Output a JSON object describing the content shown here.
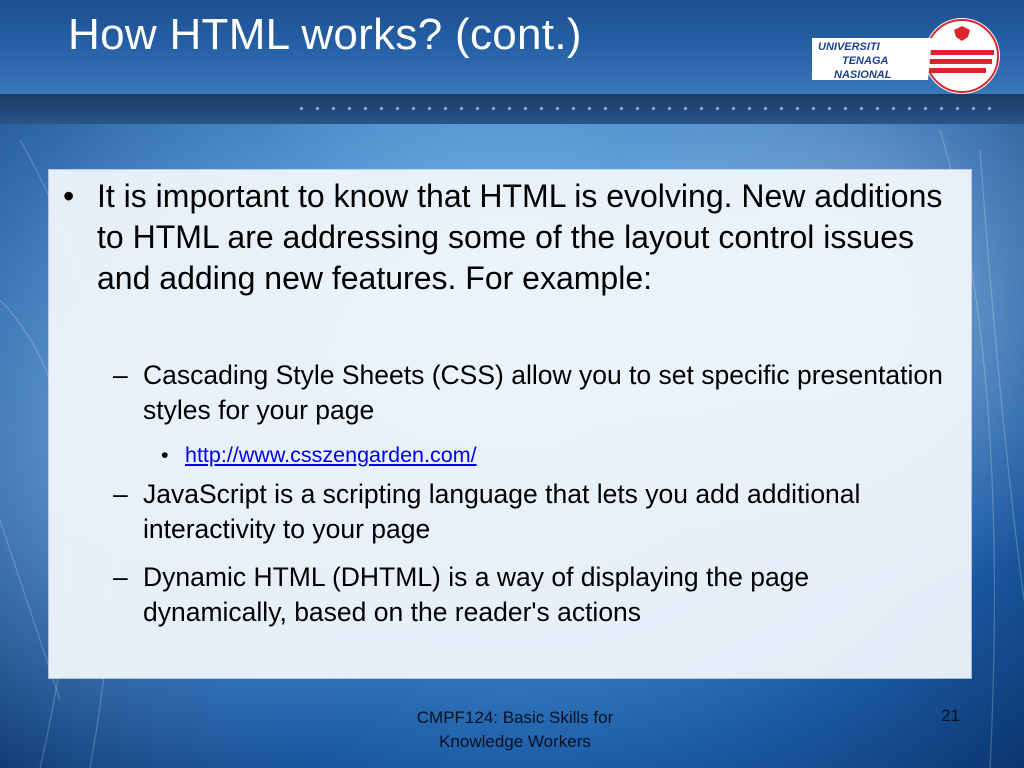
{
  "slide": {
    "title": "How HTML works? (cont.)",
    "logo": {
      "text_line1": "UNIVERSITI",
      "text_line2": "TENAGA",
      "text_line3": "NASIONAL",
      "primary_color": "#d9262c",
      "text_color": "#1f3f8f"
    },
    "bullets": {
      "main": {
        "marker": "•",
        "text": "It is important to know that HTML is evolving. New additions to HTML are addressing some of the layout control issues and adding new features. For example:"
      },
      "sub1": {
        "marker": "–",
        "text": "Cascading Style Sheets (CSS) allow you to set specific presentation styles for your page"
      },
      "link": {
        "marker": "•",
        "text": "http://www.csszengarden.com/",
        "href": "http://www.csszengarden.com/"
      },
      "sub2": {
        "marker": "–",
        "text": "JavaScript is a scripting language that lets you add additional interactivity to your page"
      },
      "sub3": {
        "marker": "–",
        "text": "Dynamic HTML (DHTML) is a way of displaying the page dynamically, based on the reader's actions"
      }
    },
    "footer": {
      "line1": "CMPF124: Basic Skills for",
      "line2": "Knowledge Workers",
      "page_number": "21"
    }
  },
  "colors": {
    "header_band": "#2862a8",
    "link": "#0000ee",
    "content_panel": "#f1f6fc"
  }
}
